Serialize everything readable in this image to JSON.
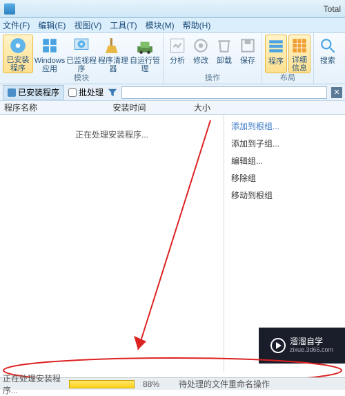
{
  "titlebar": {
    "app_name": "Total"
  },
  "menu": {
    "file": "文件(F)",
    "edit": "编辑(E)",
    "view": "视图(V)",
    "tool": "工具(T)",
    "module": "模块(M)",
    "help": "帮助(H)"
  },
  "ribbon": {
    "installed": "已安装程序",
    "winapps": "Windows 应用",
    "monitored": "已监视程序",
    "cleaner": "程序清理器",
    "autorun": "自运行管理",
    "group_modules": "模块",
    "analyze": "分析",
    "modify": "修改",
    "uninstall": "卸载",
    "save": "保存",
    "group_ops": "操作",
    "programs": "程序",
    "details": "详细信息",
    "group_layout": "布局",
    "search": "搜索"
  },
  "filter": {
    "tab": "已安装程序",
    "batch": "批处理",
    "placeholder": ""
  },
  "columns": {
    "name": "程序名称",
    "installtime": "安装时间",
    "size": "大小"
  },
  "main": {
    "processing": "正在处理安装程序..."
  },
  "sidepanel": {
    "add_root": "添加到根组...",
    "add_sub": "添加到子组...",
    "edit_group": "编辑组...",
    "remove_group": "移除组",
    "move_root": "移动到根组"
  },
  "status": {
    "processing": "正在处理安装程序...",
    "percent": "88%",
    "pending": "待处理的文件重命名操作"
  },
  "watermark": {
    "brand": "溜溜自学",
    "url": "zixue.3d66.com"
  }
}
